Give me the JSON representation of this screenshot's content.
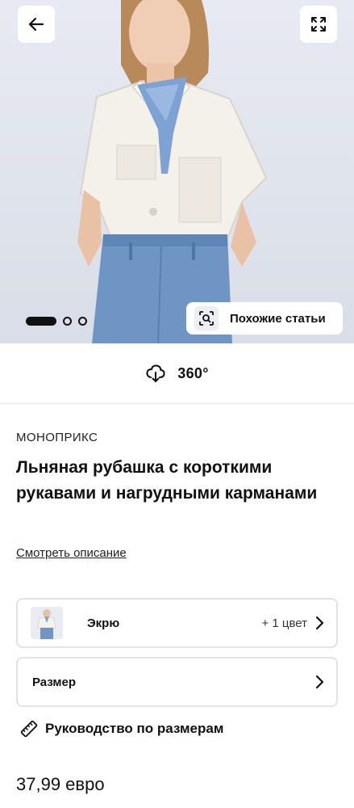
{
  "hero": {
    "back_icon": "arrow-left-icon",
    "expand_icon": "expand-icon",
    "carousel": {
      "total": 3,
      "active_index": 0
    },
    "similar_button": {
      "label": "Похожие статьи",
      "icon": "visual-search-icon"
    }
  },
  "view360": {
    "label": "360°",
    "icon": "360-rotate-icon"
  },
  "product": {
    "brand": "МОНОПРИКС",
    "title": "Льняная рубашка с короткими рукавами и нагрудными карманами",
    "description_link": "Смотреть описание",
    "color": {
      "name": "Экрю",
      "extra": "+ 1 цвет"
    },
    "size": {
      "label": "Размер"
    },
    "size_guide": {
      "label": "Руководство по размерам",
      "icon": "ruler-icon"
    },
    "price": "37,99 евро"
  },
  "colors": {
    "accent": "#111111",
    "border": "#e2e2e2",
    "hero_bg": "#e3e6ee"
  }
}
